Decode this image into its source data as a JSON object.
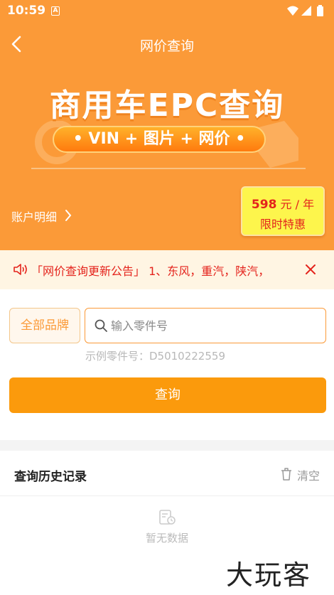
{
  "status_bar": {
    "time": "10:59",
    "notification_badge": "A"
  },
  "nav": {
    "title": "网价查询",
    "back_icon": "chevron-left-icon"
  },
  "banner": {
    "title": "商用车EPC查询",
    "subtitle": "• VIN + 图片 + 网价 •"
  },
  "account": {
    "label": "账户明细"
  },
  "price_card": {
    "price": "598",
    "unit": "元 / 年",
    "promo": "限时特惠"
  },
  "notice": {
    "text": "「网价查询更新公告」 1、东风，重汽，陕汽，",
    "icon": "speaker-icon",
    "close_icon": "close-icon"
  },
  "search": {
    "brand_button": "全部品牌",
    "placeholder": "输入零件号",
    "example": "示例零件号：D5010222559",
    "submit": "查询"
  },
  "history": {
    "title": "查询历史记录",
    "clear": "清空",
    "empty": "暂无数据"
  },
  "watermark": "大玩客",
  "colors": {
    "accent": "#fb9a38",
    "notice_red": "#e4231c",
    "price_yellow": "#fdf54c"
  }
}
